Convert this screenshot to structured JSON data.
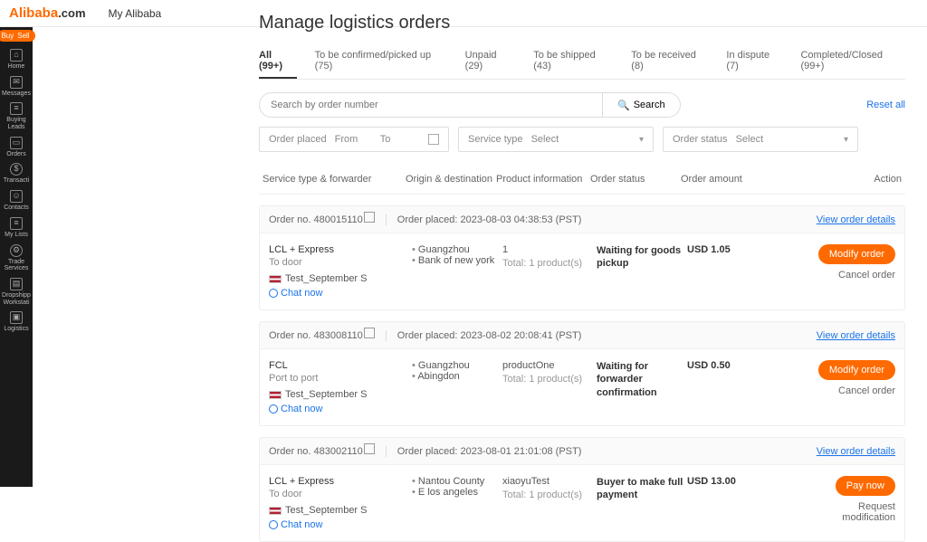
{
  "header": {
    "logo_primary": "Alibaba",
    "logo_suffix": ".com",
    "my_alibaba": "My Alibaba"
  },
  "sidebar": {
    "buy": "Buy",
    "sell": "Sell",
    "items": [
      {
        "label": "Home"
      },
      {
        "label": "Messages"
      },
      {
        "label": "Buying Leads"
      },
      {
        "label": "Orders"
      },
      {
        "label": "Transacti"
      },
      {
        "label": "Contacts"
      },
      {
        "label": "My Lists"
      },
      {
        "label": "Trade Services"
      },
      {
        "label": "Dropshipp Workstati"
      },
      {
        "label": "Logistics"
      }
    ]
  },
  "page": {
    "title": "Manage logistics orders"
  },
  "tabs": [
    {
      "label": "All (99+)",
      "active": true
    },
    {
      "label": "To be confirmed/picked up (75)"
    },
    {
      "label": "Unpaid (29)"
    },
    {
      "label": "To be shipped (43)"
    },
    {
      "label": "To be received (8)"
    },
    {
      "label": "In dispute (7)"
    },
    {
      "label": "Completed/Closed (99+)"
    }
  ],
  "filters": {
    "search_placeholder": "Search by order number",
    "search_button": "Search",
    "reset": "Reset all",
    "order_placed_label": "Order placed",
    "from": "From",
    "to": "To",
    "service_type_label": "Service type",
    "service_type_value": "Select",
    "order_status_label": "Order status",
    "order_status_value": "Select"
  },
  "columns": {
    "service": "Service type & forwarder",
    "origin": "Origin & destination",
    "product": "Product information",
    "status": "Order status",
    "amount": "Order amount",
    "action": "Action"
  },
  "labels": {
    "order_no": "Order no.",
    "order_placed": "Order placed:",
    "view_details": "View order details",
    "chat_now": "Chat now",
    "total_prefix": "Total:",
    "products_suffix": "product(s)"
  },
  "orders": [
    {
      "order_no": "480015110",
      "placed": "2023-08-03 04:38:53 (PST)",
      "service": "LCL + Express",
      "service_sub": "To door",
      "seller": "Test_September S",
      "origin": "Guangzhou",
      "destination": "Bank of new york",
      "product": "1",
      "total_count": "1",
      "status": "Waiting for goods pickup",
      "amount": "USD 1.05",
      "primary_action": "Modify order",
      "secondary_action": "Cancel order"
    },
    {
      "order_no": "483008110",
      "placed": "2023-08-02 20:08:41 (PST)",
      "service": "FCL",
      "service_sub": "Port to port",
      "seller": "Test_September S",
      "origin": "Guangzhou",
      "destination": "Abingdon",
      "product": "productOne",
      "total_count": "1",
      "status": "Waiting for forwarder confirmation",
      "amount": "USD 0.50",
      "primary_action": "Modify order",
      "secondary_action": "Cancel order"
    },
    {
      "order_no": "483002110",
      "placed": "2023-08-01 21:01:08 (PST)",
      "service": "LCL + Express",
      "service_sub": "To door",
      "seller": "Test_September S",
      "origin": "Nantou County",
      "destination": "E los angeles",
      "product": "xiaoyuTest",
      "total_count": "1",
      "status": "Buyer to make full payment",
      "amount": "USD 13.00",
      "primary_action": "Pay now",
      "secondary_action": "Request modification"
    }
  ]
}
